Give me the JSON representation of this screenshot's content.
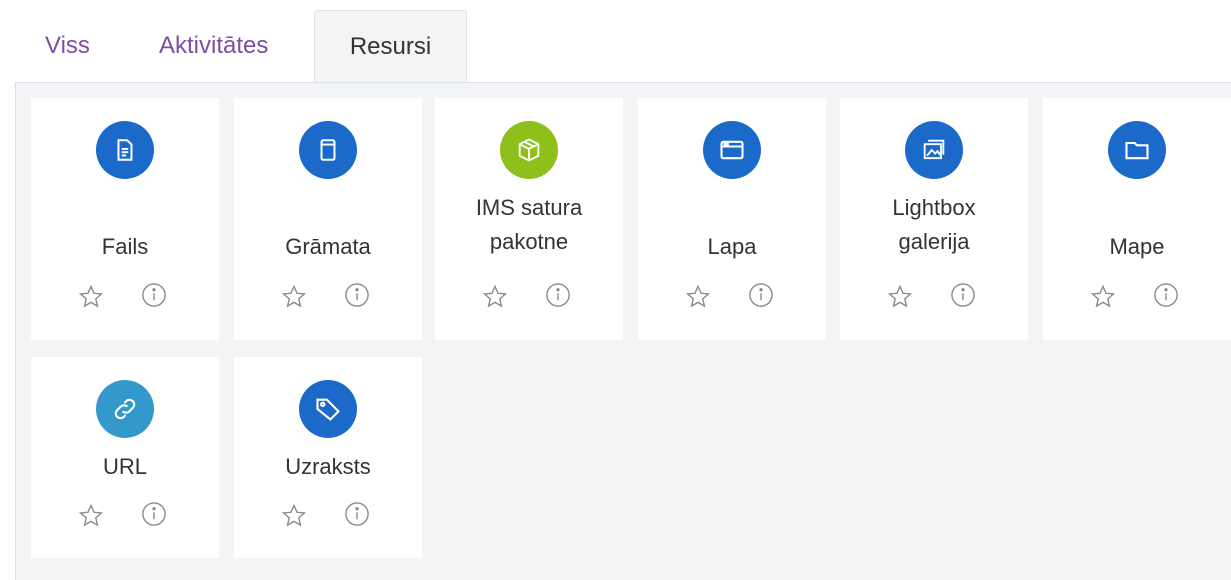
{
  "tabs": [
    {
      "label": "Viss"
    },
    {
      "label": "Aktivitātes"
    },
    {
      "label": "Resursi",
      "active": true
    }
  ],
  "colors": {
    "tab_link": "#7a4fa3",
    "active_tab_bg": "#f2f4f6",
    "panel_bg": "#f2f4f6",
    "blue_icon": "#1b6ac9",
    "green_icon": "#8ebf1a",
    "light_blue_icon": "#3399cc"
  },
  "items": [
    {
      "label_lines": [
        "Fails"
      ],
      "icon": "file-icon",
      "color": "#1b6ac9"
    },
    {
      "label_lines": [
        "Grāmata"
      ],
      "icon": "book-icon",
      "color": "#1b6ac9"
    },
    {
      "label_lines": [
        "IMS satura",
        "pakotne"
      ],
      "icon": "package-icon",
      "color": "#8ebf1a"
    },
    {
      "label_lines": [
        "Lapa"
      ],
      "icon": "page-icon",
      "color": "#1b6ac9"
    },
    {
      "label_lines": [
        "Lightbox",
        "galerija"
      ],
      "icon": "gallery-icon",
      "color": "#1b6ac9"
    },
    {
      "label_lines": [
        "Mape"
      ],
      "icon": "folder-icon",
      "color": "#1b6ac9"
    },
    {
      "label_lines": [
        "URL"
      ],
      "icon": "link-icon",
      "color": "#3399cc"
    },
    {
      "label_lines": [
        "Uzraksts"
      ],
      "icon": "label-tag-icon",
      "color": "#1b6ac9"
    }
  ],
  "action_icons": {
    "star": "star-outline-icon",
    "info": "info-circle-icon"
  }
}
